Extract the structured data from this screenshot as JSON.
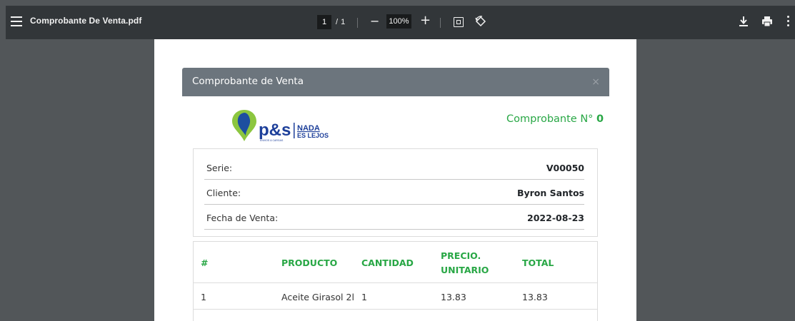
{
  "toolbar": {
    "title": "Comprobante De Venta.pdf",
    "page_current": "1",
    "page_separator": "/",
    "page_total": "1",
    "zoom_minus": "−",
    "zoom_value": "100%",
    "zoom_plus": "+",
    "icons": [
      "menu-icon",
      "fit-to-page-icon",
      "rotate-icon",
      "download-icon",
      "print-icon",
      "more-options-icon"
    ]
  },
  "modal": {
    "title": "Comprobante de Venta",
    "close": "×"
  },
  "logo": {
    "brand": "p&s",
    "tagline_top": "NADA",
    "tagline_bottom": "ES LEJOS",
    "small_text": "ENVIOS & CARGAS",
    "colors": {
      "pin_green": "#8cc63f",
      "pin_blue": "#1d4fa0",
      "text_blue": "#1d3f9a"
    }
  },
  "comprobante": {
    "label": "Comprobante N°",
    "number": "0"
  },
  "info": [
    {
      "label": "Serie:",
      "value": "V00050"
    },
    {
      "label": "Cliente:",
      "value": "Byron Santos"
    },
    {
      "label": "Fecha de Venta:",
      "value": "2022-08-23"
    }
  ],
  "table": {
    "headers": [
      "#",
      "PRODUCTO",
      "CANTIDAD",
      "PRECIO.",
      "UNITARIO",
      "TOTAL"
    ],
    "rows": [
      [
        "1",
        "Aceite Girasol 2l",
        "1",
        "13.83",
        "13.83"
      ]
    ]
  },
  "colors": {
    "toolbar_bg": "#323639",
    "viewer_bg": "#525659",
    "modal_header": "#6c757d",
    "accent_green": "#28a745"
  }
}
